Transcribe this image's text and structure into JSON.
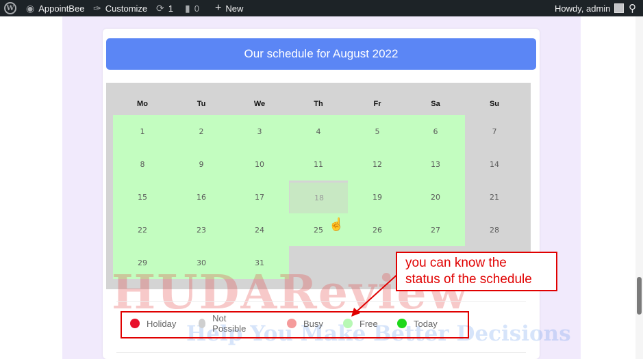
{
  "adminbar": {
    "wp_logo": "W",
    "site_name": "AppointBee",
    "customize": "Customize",
    "updates_count": "1",
    "comments_count": "0",
    "new_label": "New",
    "howdy": "Howdy, admin",
    "icons": {
      "site": "dashboard-icon",
      "customize": "brush-icon",
      "updates": "refresh-icon",
      "comments": "comment-icon",
      "new": "plus-icon",
      "search": "search-icon"
    }
  },
  "schedule": {
    "title": "Our schedule for August 2022",
    "days_of_week": [
      "Mo",
      "Tu",
      "We",
      "Th",
      "Fr",
      "Sa",
      "Su"
    ],
    "weeks": [
      [
        {
          "d": "1",
          "s": "free"
        },
        {
          "d": "2",
          "s": "free"
        },
        {
          "d": "3",
          "s": "free"
        },
        {
          "d": "4",
          "s": "free"
        },
        {
          "d": "5",
          "s": "free"
        },
        {
          "d": "6",
          "s": "free"
        },
        {
          "d": "7",
          "s": "closed"
        }
      ],
      [
        {
          "d": "8",
          "s": "free"
        },
        {
          "d": "9",
          "s": "free"
        },
        {
          "d": "10",
          "s": "free"
        },
        {
          "d": "11",
          "s": "free"
        },
        {
          "d": "12",
          "s": "free"
        },
        {
          "d": "13",
          "s": "free"
        },
        {
          "d": "14",
          "s": "closed"
        }
      ],
      [
        {
          "d": "15",
          "s": "free"
        },
        {
          "d": "16",
          "s": "free"
        },
        {
          "d": "17",
          "s": "free"
        },
        {
          "d": "18",
          "s": "dim"
        },
        {
          "d": "19",
          "s": "free"
        },
        {
          "d": "20",
          "s": "free"
        },
        {
          "d": "21",
          "s": "closed"
        }
      ],
      [
        {
          "d": "22",
          "s": "free"
        },
        {
          "d": "23",
          "s": "free"
        },
        {
          "d": "24",
          "s": "free"
        },
        {
          "d": "25",
          "s": "free"
        },
        {
          "d": "26",
          "s": "free"
        },
        {
          "d": "27",
          "s": "free"
        },
        {
          "d": "28",
          "s": "closed"
        }
      ],
      [
        {
          "d": "29",
          "s": "free"
        },
        {
          "d": "30",
          "s": "free"
        },
        {
          "d": "31",
          "s": "free"
        },
        {
          "d": "",
          "s": "closed"
        },
        {
          "d": "",
          "s": "closed"
        },
        {
          "d": "",
          "s": "closed"
        },
        {
          "d": "",
          "s": "closed"
        }
      ]
    ]
  },
  "legend": {
    "items": [
      {
        "label": "Holiday",
        "color": "#e8102a"
      },
      {
        "label": "Not Possible",
        "color": "#cfcfcf"
      },
      {
        "label": "Busy",
        "color": "#f59b9b"
      },
      {
        "label": "Free",
        "color": "#b8f8b4"
      },
      {
        "label": "Today",
        "color": "#1ed81a"
      }
    ]
  },
  "annotation": {
    "line1": "you can know the",
    "line2": "status of the schedule",
    "color": "#e00000"
  },
  "watermark": {
    "main": "HUDAReview",
    "tagline": "Help You Make Better Decisions"
  },
  "cursor_icon": "hand-pointer-icon"
}
